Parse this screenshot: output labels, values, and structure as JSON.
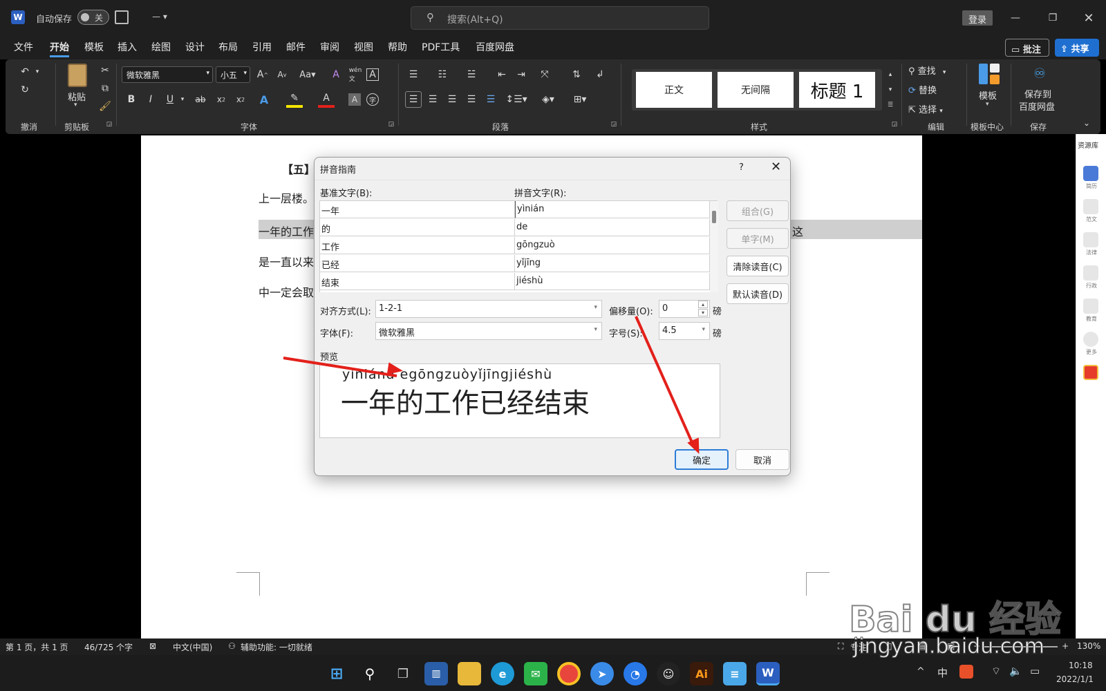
{
  "titlebar": {
    "autosave_label": "自动保存",
    "autosave_state": "关",
    "search_placeholder": "搜索(Alt+Q)",
    "login_label": "登录"
  },
  "menu": {
    "items": [
      "文件",
      "开始",
      "模板",
      "插入",
      "绘图",
      "设计",
      "布局",
      "引用",
      "邮件",
      "审阅",
      "视图",
      "帮助",
      "PDF工具",
      "百度网盘"
    ],
    "active": "开始",
    "comment_label": "批注",
    "share_label": "共享"
  },
  "ribbon": {
    "groups": {
      "undo": "撤消",
      "clipboard": "剪贴板",
      "font": "字体",
      "paragraph": "段落",
      "styles": "样式",
      "editing": "编辑",
      "template_center": "模板中心",
      "save": "保存"
    },
    "paste_label": "粘贴",
    "font_name": "微软雅黑",
    "font_size": "小五",
    "styles": [
      "正文",
      "无间隔",
      "标题 1"
    ],
    "find_label": "查找",
    "replace_label": "替换",
    "select_label": "选择",
    "template_label": "模板",
    "save_baidu_label_1": "保存到",
    "save_baidu_label_2": "百度网盘"
  },
  "document": {
    "line1": "【五】",
    "line2": "上一层楼。",
    "line3": "一年的工作",
    "line3_tail": "这",
    "line4": "是一直以来",
    "line5": "中一定会取"
  },
  "right_pane": {
    "title": "资源库",
    "items": [
      "简历",
      "范文",
      "法律",
      "行政",
      "教育",
      "更多"
    ]
  },
  "dialog": {
    "title": "拼音指南",
    "help": "?",
    "base_label": "基准文字(B):",
    "ruby_label": "拼音文字(R):",
    "rows": [
      {
        "base": "一年",
        "ruby": "yìnián"
      },
      {
        "base": "的",
        "ruby": "de"
      },
      {
        "base": "工作",
        "ruby": "gōngzuò"
      },
      {
        "base": "已经",
        "ruby": "yǐjīng"
      },
      {
        "base": "结束",
        "ruby": "jiéshù"
      }
    ],
    "buttons": {
      "group": "组合(G)",
      "mono": "单字(M)",
      "clear": "清除读音(C)",
      "default": "默认读音(D)",
      "ok": "确定",
      "cancel": "取消"
    },
    "alignment_label": "对齐方式(L):",
    "alignment_value": "1-2-1",
    "offset_label": "偏移量(O):",
    "offset_value": "0",
    "font_label": "字体(F):",
    "font_value": "微软雅黑",
    "size_label": "字号(S):",
    "size_value": "4.5",
    "unit": "磅",
    "preview_label": "预览",
    "preview_ruby": "yìniánd egōngzuòyǐjīngjiéshù",
    "preview_text": "一年的工作已经结束"
  },
  "statusbar": {
    "page": "第 1 页，共 1 页",
    "words": "46/725 个字",
    "language": "中文(中国)",
    "accessibility": "辅助功能: 一切就绪",
    "focus": "专注",
    "zoom": "130%"
  },
  "taskbar": {
    "ime": "中",
    "time": "10:18",
    "date": "2022/1/1"
  },
  "watermark": {
    "logo": "Bai du 经验",
    "url": "jingyan.baidu.com"
  },
  "colors": {
    "accent": "#4a9be8",
    "arrow": "#e3201b",
    "ok_border": "#2c7cd6"
  }
}
